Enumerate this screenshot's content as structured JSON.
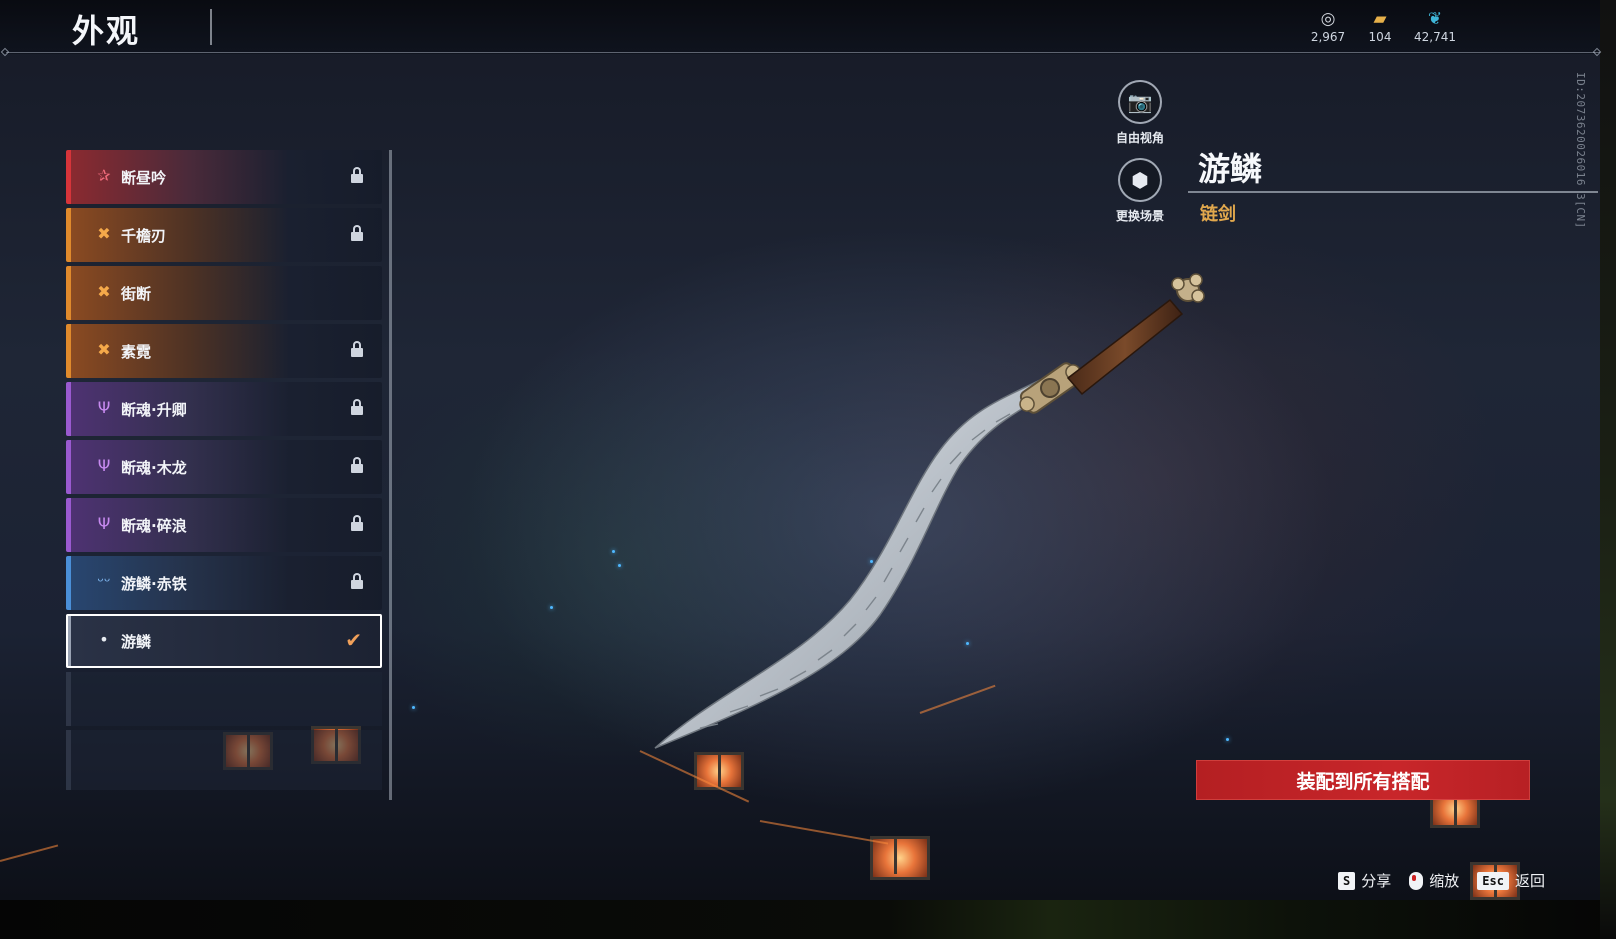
{
  "header": {
    "title": "外观"
  },
  "currencies": [
    {
      "icon": "coin-icon",
      "value": "2,967"
    },
    {
      "icon": "ticket-icon",
      "value": "104"
    },
    {
      "icon": "feather-icon",
      "value": "42,741"
    }
  ],
  "id_text": "ID:2073620026016 3[CN]",
  "list": {
    "items": [
      {
        "label": "断昼吟",
        "rarity_icon": "star-icon",
        "color": "#d6343a",
        "locked": true
      },
      {
        "label": "千檐刃",
        "rarity_icon": "cross-icon",
        "color": "#e08a2c",
        "locked": true
      },
      {
        "label": "街断",
        "rarity_icon": "cross-icon",
        "color": "#e08a2c",
        "locked": false
      },
      {
        "label": "素霓",
        "rarity_icon": "cross-icon",
        "color": "#e08a2c",
        "locked": true
      },
      {
        "label": "断魂·升卿",
        "rarity_icon": "trident-icon",
        "color": "#9a5ad0",
        "locked": true
      },
      {
        "label": "断魂·木龙",
        "rarity_icon": "trident-icon",
        "color": "#9a5ad0",
        "locked": true
      },
      {
        "label": "断魂·碎浪",
        "rarity_icon": "trident-icon",
        "color": "#9a5ad0",
        "locked": true
      },
      {
        "label": "游鳞·赤铁",
        "rarity_icon": "wings-icon",
        "color": "#4a8fd8",
        "locked": true
      },
      {
        "label": "游鳞",
        "rarity_icon": "drop-icon",
        "color": "#9aa3b4",
        "locked": false,
        "selected": true
      }
    ]
  },
  "view_controls": {
    "free_view": "自由视角",
    "change_scene": "更换场景"
  },
  "detail": {
    "name": "游鳞",
    "type": "链剑"
  },
  "equip_button": "装配到所有搭配",
  "hints": [
    {
      "key": "S",
      "label": "分享"
    },
    {
      "key": "mouse",
      "label": "缩放"
    },
    {
      "key": "Esc",
      "label": "返回"
    }
  ]
}
